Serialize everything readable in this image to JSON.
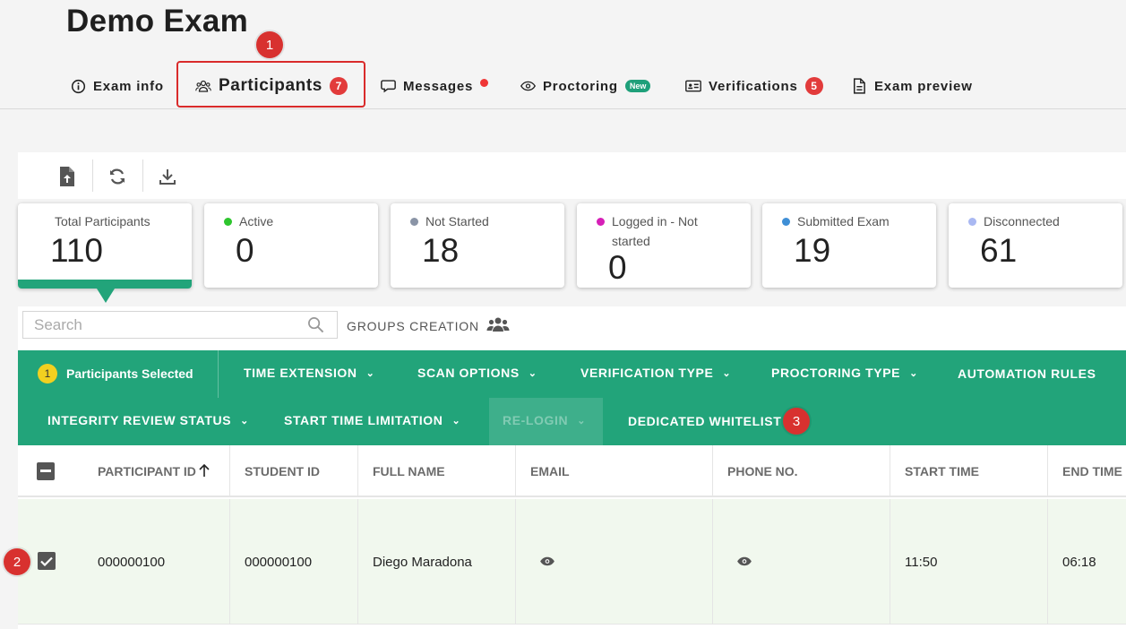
{
  "page": {
    "title": "Demo Exam"
  },
  "tabs": [
    {
      "label": "Exam info",
      "icon": "info-icon"
    },
    {
      "label": "Participants",
      "icon": "users-icon",
      "badge": "7"
    },
    {
      "label": "Messages",
      "icon": "message-icon",
      "dot": true
    },
    {
      "label": "Proctoring",
      "icon": "eye-icon",
      "pill": "New"
    },
    {
      "label": "Verifications",
      "icon": "id-card-icon",
      "badge": "5"
    },
    {
      "label": "Exam preview",
      "icon": "document-icon"
    }
  ],
  "markers": [
    "1",
    "2",
    "3"
  ],
  "toolbar": {
    "icons": [
      "upload-file-icon",
      "refresh-icon",
      "download-icon"
    ]
  },
  "stats": [
    {
      "label": "Total Participants",
      "value": "110",
      "color": ""
    },
    {
      "label": "Active",
      "value": "0",
      "color": "#2ec52e"
    },
    {
      "label": "Not Started",
      "value": "18",
      "color": "#8a94a6"
    },
    {
      "label": "Logged in - Not started",
      "value": "0",
      "color": "#d61fb7"
    },
    {
      "label": "Submitted Exam",
      "value": "19",
      "color": "#3f8fd6"
    },
    {
      "label": "Disconnected",
      "value": "61",
      "color": "#a9b8f2"
    }
  ],
  "search": {
    "placeholder": "Search"
  },
  "groups_creation": {
    "label": "GROUPS CREATION"
  },
  "actions": {
    "selected_count": "1",
    "selected_label": "Participants Selected",
    "time_extension": "TIME EXTENSION",
    "scan_options": "SCAN OPTIONS",
    "verification_type": "VERIFICATION TYPE",
    "proctoring_type": "PROCTORING TYPE",
    "automation_rules": "AUTOMATION RULES",
    "integrity_review_status": "INTEGRITY REVIEW STATUS",
    "start_time_limitation": "START TIME LIMITATION",
    "re_login": "RE-LOGIN",
    "dedicated_whitelist": "DEDICATED WHITELIST"
  },
  "table": {
    "columns": [
      "PARTICIPANT ID",
      "STUDENT ID",
      "FULL NAME",
      "EMAIL",
      "PHONE NO.",
      "START TIME",
      "END TIME"
    ],
    "sort_column": "PARTICIPANT ID",
    "rows": [
      {
        "participant_id": "000000100",
        "student_id": "000000100",
        "full_name": "Diego Maradona",
        "start_time": "11:50",
        "end_time": "06:18",
        "selected": true
      }
    ]
  },
  "colors": {
    "accent": "#22a47a",
    "marker": "#d8312f",
    "badge": "#e23b3b"
  }
}
